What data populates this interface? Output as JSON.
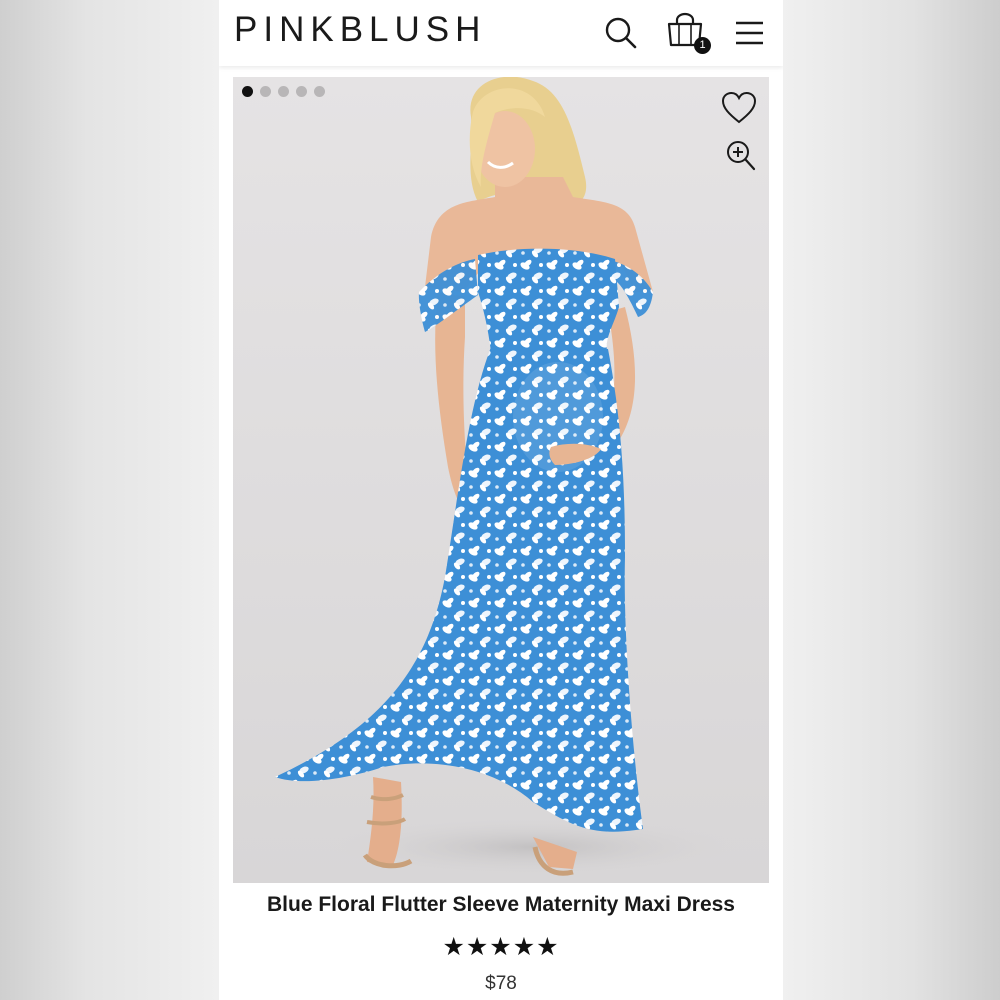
{
  "header": {
    "logo": "PINKBLUSH",
    "search_icon": "search-icon",
    "bag_icon": "shopping-bag-icon",
    "bag_count": "1",
    "menu_icon": "hamburger-menu-icon"
  },
  "product": {
    "image_alt": "model wearing blue floral off-shoulder maxi dress",
    "carousel": {
      "total": 5,
      "active": 1
    },
    "wishlist_icon": "heart-icon",
    "zoom_icon": "zoom-in-icon",
    "title": "Blue Floral Flutter Sleeve Maternity Maxi Dress",
    "rating": {
      "stars": "★★★★★",
      "value": 5,
      "max": 5
    },
    "price": "$78"
  },
  "colors": {
    "dress_blue": "#3d8fd6",
    "background": "#e2e0e1",
    "text": "#1a1a1a"
  }
}
